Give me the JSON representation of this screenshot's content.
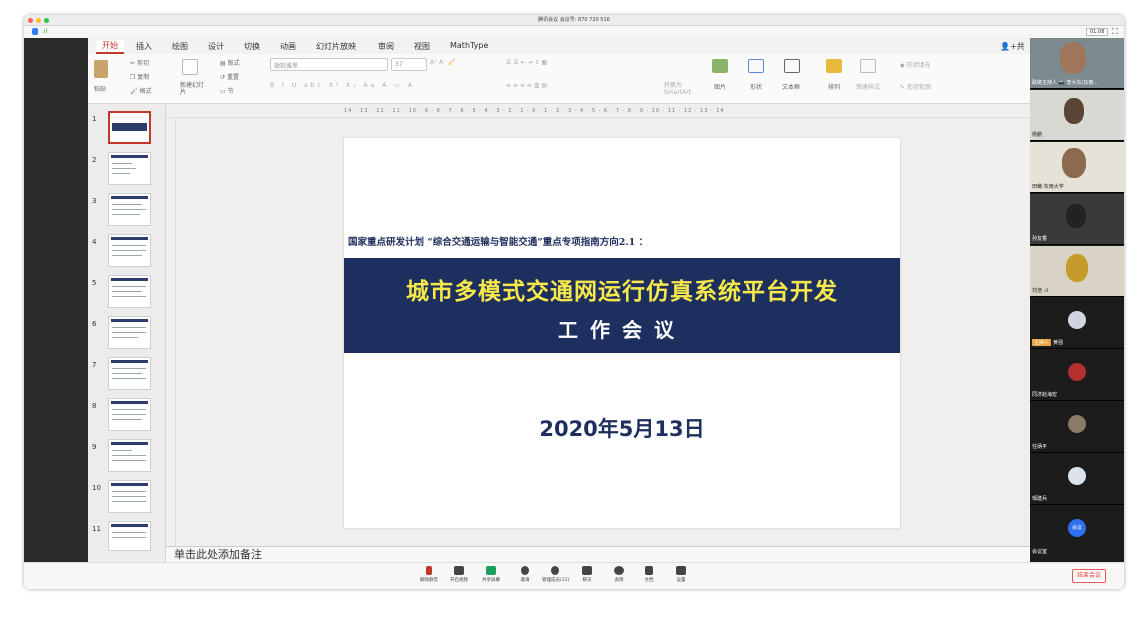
{
  "window": {
    "title": "腾讯会议 会议号: 870 720 516",
    "timer": "01:08"
  },
  "ribbon": {
    "tabs": [
      "开始",
      "插入",
      "绘图",
      "设计",
      "切换",
      "动画",
      "幻灯片放映",
      "审阅",
      "视图",
      "MathType"
    ],
    "active_tab": "开始",
    "share": "共",
    "clipboard": {
      "paste": "粘贴",
      "cut": "剪切",
      "copy": "复制",
      "format": "格式"
    },
    "slides": {
      "new_slide": "新建幻灯片",
      "layout": "版式",
      "reset": "重置",
      "section": "节"
    },
    "font": {
      "name": "微软雅黑",
      "size": "37"
    },
    "convert": "转换为SmartArt",
    "insert": {
      "picture": "图片",
      "shape": "形状",
      "textbox": "文本框"
    },
    "arrange": "排列",
    "quick_styles": "快速样式",
    "shape_fill": "形状填充",
    "shape_outline": "形状轮廓"
  },
  "ruler": {
    "ticks": "14 · 13 · 12 · 11 · 10 · 9 · 8 · 7 · 6 · 5 · 4 · 3 · 2 · 1 · 0 · 1 · 2 · 3 · 4 · 5 · 6 · 7 · 8 · 9 · 10 · 11 · 12 · 13 · 14"
  },
  "thumbnails": {
    "numbers": [
      "1",
      "2",
      "3",
      "4",
      "5",
      "6",
      "7",
      "8",
      "9",
      "10",
      "11"
    ]
  },
  "slide": {
    "subtitle": "国家重点研发计划 “综合交通运输与智能交通”重点专项指南方向2.1 ：",
    "title_line1": "城市多模式交通网运行仿真系统平台开发",
    "title_line2": "工作会议",
    "date": "2020年5月13日"
  },
  "notes": {
    "placeholder": "单击此处添加备注"
  },
  "participants": [
    {
      "name": "联席主持人 📷 李大东(东南..."
    },
    {
      "name": "杨鹏"
    },
    {
      "name": "田耀-东南大学"
    },
    {
      "name": "孙友香"
    },
    {
      "name": "刘浩 .ıl"
    },
    {
      "name": "黄强",
      "host_badge": "主持人"
    },
    {
      "name": "同济赵海宏"
    },
    {
      "name": "任炳平"
    },
    {
      "name": "邹建兵"
    },
    {
      "name": "会议室",
      "avatar_text": "会议"
    }
  ],
  "toolbar": {
    "items": [
      "解除静音",
      "开启视频",
      "共享屏幕",
      "邀请",
      "管理成员(12)",
      "聊天",
      "表情",
      "文档",
      "设置"
    ],
    "end": "结束会议"
  }
}
